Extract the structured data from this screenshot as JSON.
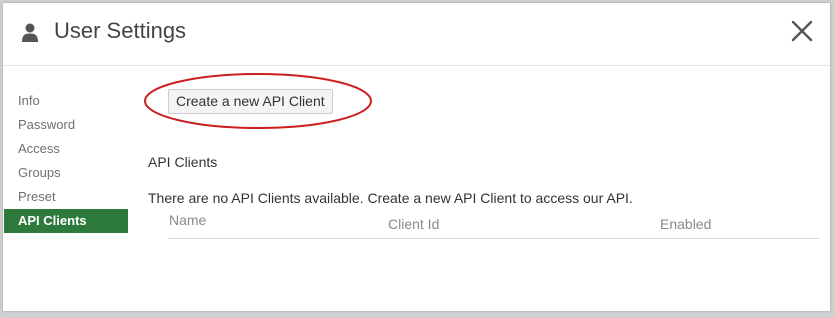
{
  "dialog": {
    "title": "User Settings",
    "close_icon": "close-icon",
    "user_icon": "user-icon"
  },
  "sidebar": {
    "items": [
      {
        "label": "Info",
        "active": false
      },
      {
        "label": "Password",
        "active": false
      },
      {
        "label": "Access",
        "active": false
      },
      {
        "label": "Groups",
        "active": false
      },
      {
        "label": "Preset",
        "active": false
      },
      {
        "label": "API Clients",
        "active": true
      }
    ]
  },
  "main": {
    "create_button_label": "Create a new API Client",
    "section_title": "API Clients",
    "empty_message": "There are no API Clients available. Create a new API Client to access our API.",
    "table": {
      "columns": [
        "Name",
        "Client Id",
        "Enabled"
      ],
      "rows": []
    }
  },
  "colors": {
    "active_nav_bg": "#2e7a3c",
    "highlight_oval": "#cc1f1f",
    "title_text": "#444444"
  }
}
